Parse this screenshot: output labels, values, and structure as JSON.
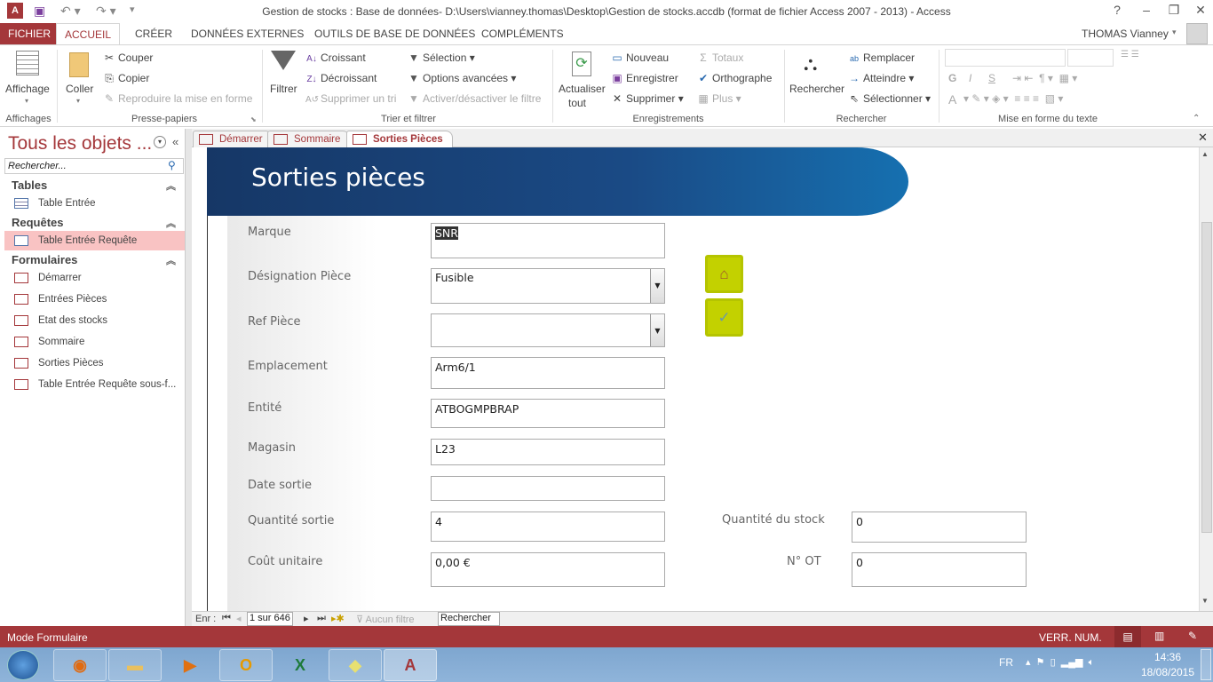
{
  "window": {
    "title": "Gestion de stocks : Base de données- D:\\Users\\vianney.thomas\\Desktop\\Gestion de stocks.accdb (format de fichier Access 2007 - 2013) - Access",
    "help": "?",
    "minimize": "–",
    "restore": "❐",
    "close": "✕"
  },
  "ribbon_tabs": [
    "FICHIER",
    "ACCUEIL",
    "CRÉER",
    "DONNÉES EXTERNES",
    "OUTILS DE BASE DE DONNÉES",
    "COMPLÉMENTS"
  ],
  "user": "THOMAS Vianney",
  "ribbon": {
    "affichage": "Affichage",
    "affichages_group": "Affichages",
    "coller": "Coller",
    "couper": "Couper",
    "copier": "Copier",
    "reproduire": "Reproduire la mise en forme",
    "presse_group": "Presse-papiers",
    "filtrer": "Filtrer",
    "croissant": "Croissant",
    "decroissant": "Décroissant",
    "supprimer_tri": "Supprimer un tri",
    "selection": "Sélection",
    "options_avancees": "Options avancées",
    "activer_filtre": "Activer/désactiver le filtre",
    "trier_group": "Trier et filtrer",
    "actualiser": "Actualiser",
    "tout": "tout",
    "nouveau": "Nouveau",
    "enregistrer": "Enregistrer",
    "supprimer": "Supprimer",
    "totaux": "Totaux",
    "orthographe": "Orthographe",
    "plus": "Plus",
    "enreg_group": "Enregistrements",
    "rechercher": "Rechercher",
    "remplacer": "Remplacer",
    "atteindre": "Atteindre",
    "selectionner": "Sélectionner",
    "rech_group": "Rechercher",
    "texte_group": "Mise en forme du texte",
    "bold": "G",
    "italic": "I",
    "underline": "S",
    "fontcolor": "A"
  },
  "nav": {
    "title": "Tous les objets ...",
    "search_placeholder": "Rechercher...",
    "groups": [
      {
        "label": "Tables",
        "items": [
          "Table Entrée"
        ]
      },
      {
        "label": "Requêtes",
        "items": [
          "Table Entrée Requête"
        ]
      },
      {
        "label": "Formulaires",
        "items": [
          "Démarrer",
          "Entrées Pièces",
          "Etat des stocks",
          "Sommaire",
          "Sorties Pièces",
          "Table Entrée Requête sous-f..."
        ]
      }
    ],
    "selected": "Table Entrée Requête"
  },
  "doc_tabs": [
    "Démarrer",
    "Sommaire",
    "Sorties Pièces"
  ],
  "active_doc_tab": "Sorties Pièces",
  "form": {
    "title": "Sorties pièces",
    "fields": [
      {
        "label": "Marque",
        "value": "SNR"
      },
      {
        "label": "Désignation Pièce",
        "value": "Fusible"
      },
      {
        "label": "Ref Pièce",
        "value": ""
      },
      {
        "label": "Emplacement",
        "value": "Arm6/1"
      },
      {
        "label": "Entité",
        "value": "ATBOGMPBRAP"
      },
      {
        "label": "Magasin",
        "value": "L23"
      },
      {
        "label": "Date sortie",
        "value": ""
      },
      {
        "label": "Quantité sortie",
        "value": "4"
      },
      {
        "label": "Coût unitaire",
        "value": "0,00 €"
      },
      {
        "label": "Quantité du stock",
        "value": "0"
      },
      {
        "label": "N° OT",
        "value": "0"
      }
    ],
    "accent_color": "#c3d100"
  },
  "record_nav": {
    "label": "Enr :",
    "position": "1 sur 646",
    "filter": "Aucun filtre",
    "search": "Rechercher"
  },
  "status": {
    "mode": "Mode Formulaire",
    "numlock": "VERR. NUM."
  },
  "taskbar": {
    "lang": "FR",
    "time": "14:36",
    "date": "18/08/2015"
  },
  "colors": {
    "access_red": "#a4373a",
    "banner_blue": "#163766"
  }
}
